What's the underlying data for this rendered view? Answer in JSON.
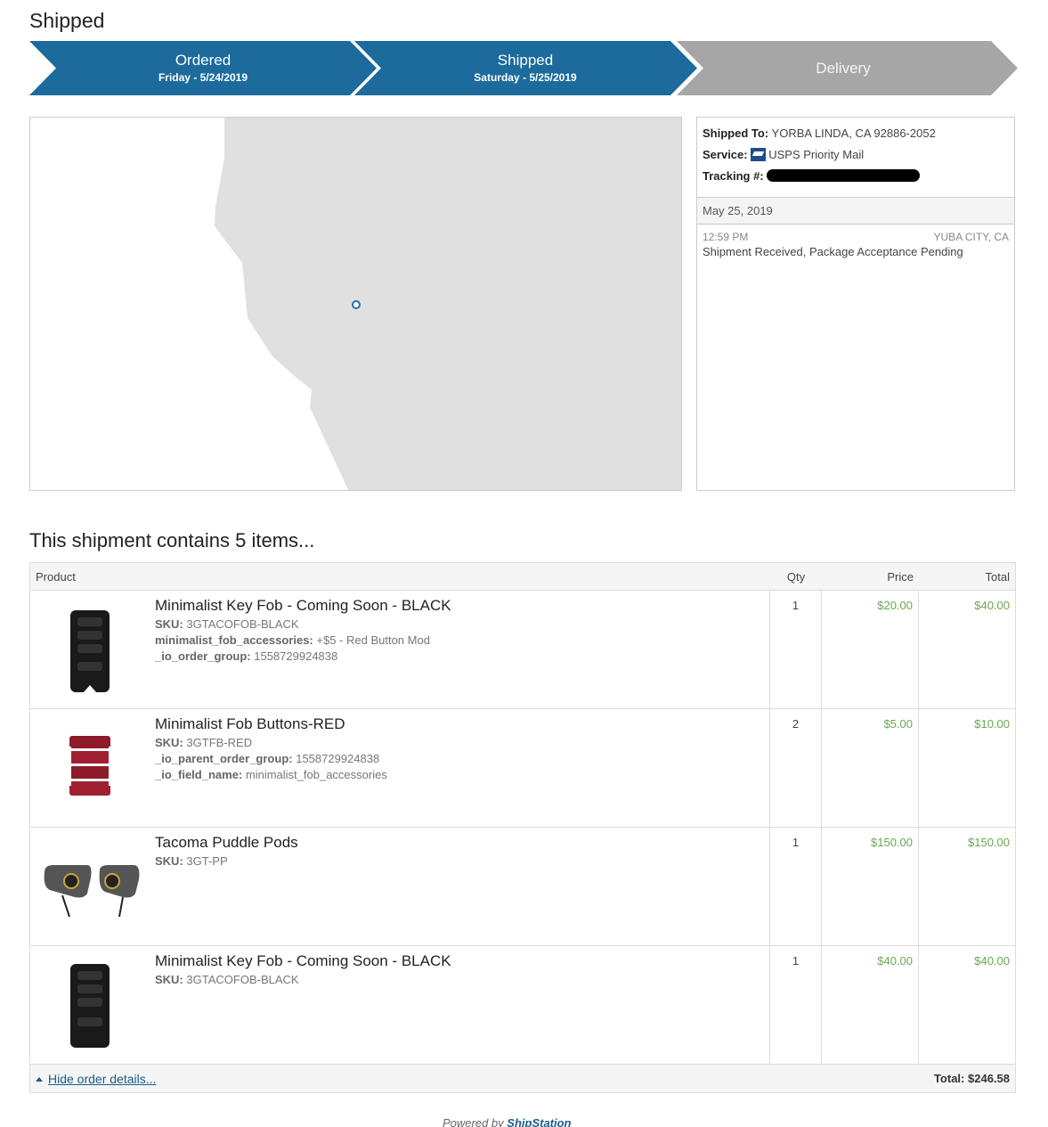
{
  "page_title": "Shipped",
  "steps": [
    {
      "name": "Ordered",
      "date": "Friday - 5/24/2019",
      "state": "done"
    },
    {
      "name": "Shipped",
      "date": "Saturday - 5/25/2019",
      "state": "done"
    },
    {
      "name": "Delivery",
      "date": "",
      "state": "pending"
    }
  ],
  "colors": {
    "step_done": "#1c6b9c",
    "step_pending": "#a6a6a6",
    "map_land": "#e0e0e0",
    "map_marker": "#2a6ea6",
    "price_green": "#6aa84f"
  },
  "tracking": {
    "shipped_to_label": "Shipped To:",
    "shipped_to": "YORBA LINDA, CA 92886-2052",
    "service_label": "Service:",
    "service_icon": "usps-eagle-icon",
    "service": "USPS Priority Mail",
    "tracking_label": "Tracking #:",
    "day": "May 25, 2019",
    "events": [
      {
        "time": "12:59 PM",
        "location": "YUBA CITY, CA",
        "description": "Shipment Received, Package Acceptance Pending"
      }
    ]
  },
  "items_heading": "This shipment contains 5 items...",
  "table": {
    "headers": {
      "product": "Product",
      "qty": "Qty",
      "price": "Price",
      "total": "Total"
    },
    "rows": [
      {
        "name": "Minimalist Key Fob - Coming Soon - BLACK",
        "image": "black-key-fob-image",
        "attrs": [
          {
            "label": "SKU:",
            "value": "3GTACOFOB-BLACK"
          },
          {
            "label": "minimalist_fob_accessories:",
            "value": "+$5 - Red Button Mod"
          },
          {
            "label": "_io_order_group:",
            "value": "1558729924838"
          }
        ],
        "qty": "1",
        "price": "$20.00",
        "total": "$40.00"
      },
      {
        "name": "Minimalist Fob Buttons-RED",
        "image": "red-fob-buttons-image",
        "attrs": [
          {
            "label": "SKU:",
            "value": "3GTFB-RED"
          },
          {
            "label": "_io_parent_order_group:",
            "value": "1558729924838"
          },
          {
            "label": "_io_field_name:",
            "value": "minimalist_fob_accessories"
          }
        ],
        "qty": "2",
        "price": "$5.00",
        "total": "$10.00"
      },
      {
        "name": "Tacoma Puddle Pods",
        "image": "puddle-pods-image",
        "attrs": [
          {
            "label": "SKU:",
            "value": "3GT-PP"
          }
        ],
        "qty": "1",
        "price": "$150.00",
        "total": "$150.00"
      },
      {
        "name": "Minimalist Key Fob - Coming Soon - BLACK",
        "image": "black-key-fob-image",
        "attrs": [
          {
            "label": "SKU:",
            "value": "3GTACOFOB-BLACK"
          }
        ],
        "qty": "1",
        "price": "$40.00",
        "total": "$40.00"
      }
    ],
    "hide_details": "Hide order details...",
    "grand_total_label": "Total:",
    "grand_total": "$246.58"
  },
  "powered_by": "Powered by",
  "powered_brand": "ShipStation"
}
